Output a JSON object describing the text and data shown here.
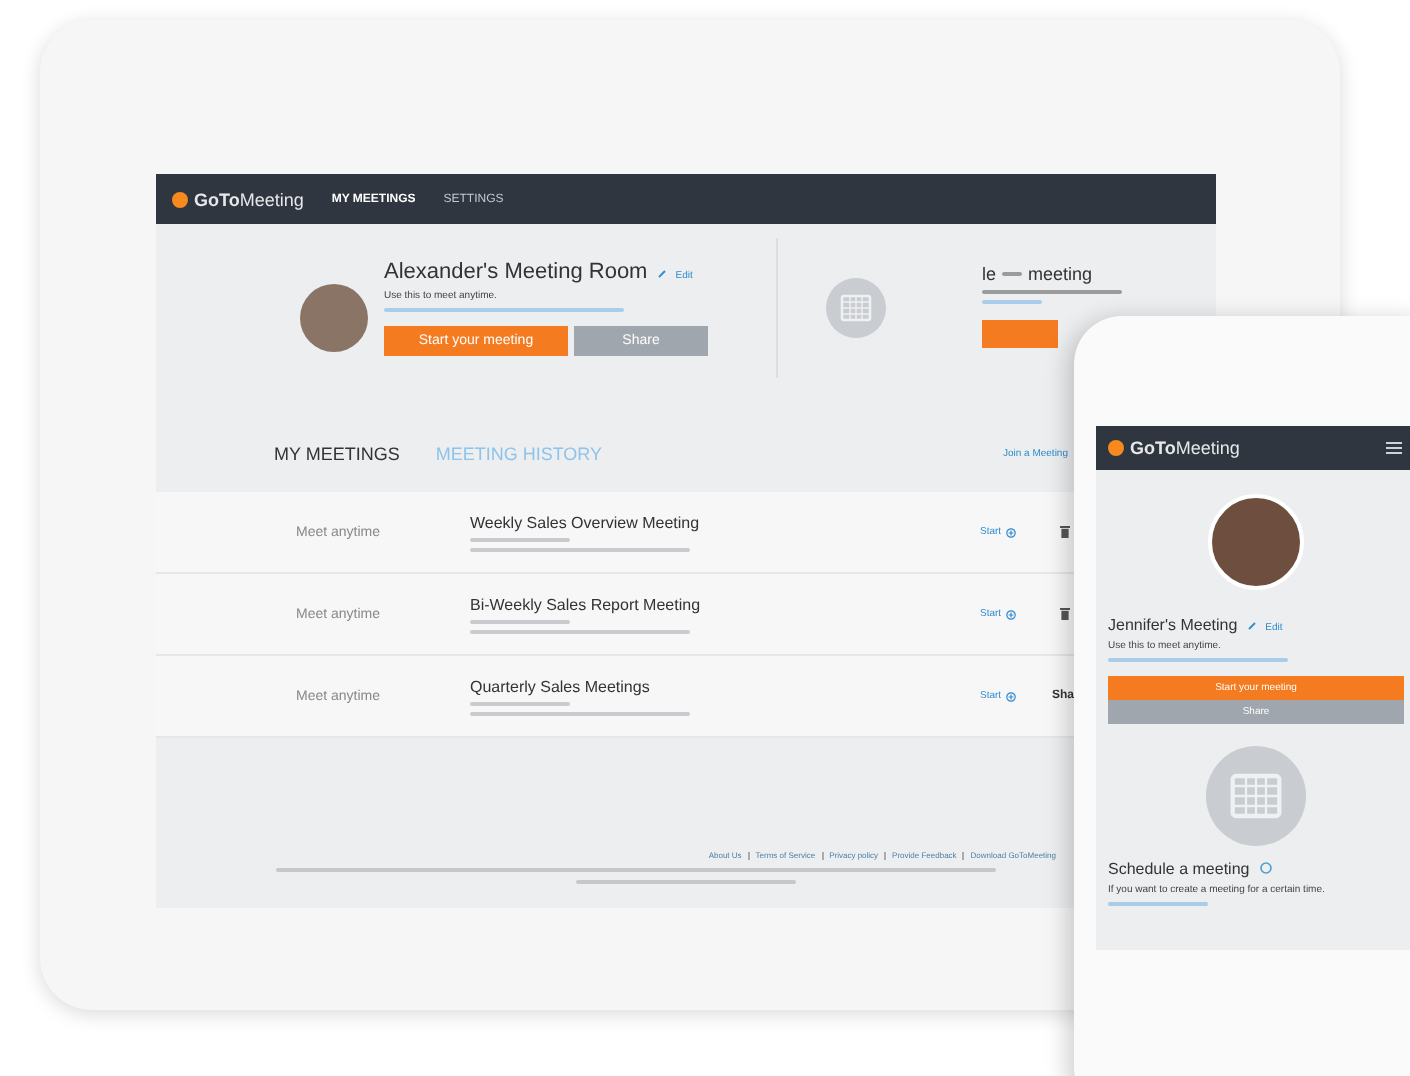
{
  "tablet": {
    "nav": {
      "logo_bold": "GoTo",
      "logo_light": "Meeting",
      "items": [
        {
          "label": "MY MEETINGS",
          "selected": true
        },
        {
          "label": "SETTINGS",
          "selected": false
        }
      ]
    },
    "room": {
      "title": "Alexander's Meeting Room",
      "edit": "Edit",
      "hint": "Use this to meet anytime.",
      "start_button": "Start your meeting",
      "share_button": "Share"
    },
    "schedule": {
      "title": "le",
      "title_end": "meeting"
    },
    "tabs": [
      {
        "label": "MY MEETINGS",
        "selected": true
      },
      {
        "label": "MEETING HISTORY",
        "selected": false
      }
    ],
    "join_link": "Join a Meeting",
    "meetings": [
      {
        "time": "Meet anytime",
        "title": "Weekly Sales Overview Meeting",
        "action": "Start",
        "end": {
          "kind": "trash"
        }
      },
      {
        "time": "Meet anytime",
        "title": "Bi-Weekly Sales Report Meeting",
        "action": "Start",
        "end": {
          "kind": "trash"
        }
      },
      {
        "time": "Meet anytime",
        "title": "Quarterly Sales Meetings",
        "action": "Start",
        "end": {
          "kind": "text",
          "text": "Sha"
        }
      }
    ],
    "footer_links": [
      "About Us",
      "Terms of Service",
      "Privacy policy",
      "Provide Feedback",
      "Download GoToMeeting"
    ]
  },
  "phone": {
    "logo_bold": "GoTo",
    "logo_light": "Meeting",
    "room": {
      "title": "Jennifer's Meeting",
      "edit": "Edit",
      "hint": "Use this to meet anytime.",
      "start_button": "Start your meeting",
      "share_button": "Share"
    },
    "schedule": {
      "title": "Schedule a meeting",
      "hint": "If you want to create a meeting for a certain time."
    }
  }
}
